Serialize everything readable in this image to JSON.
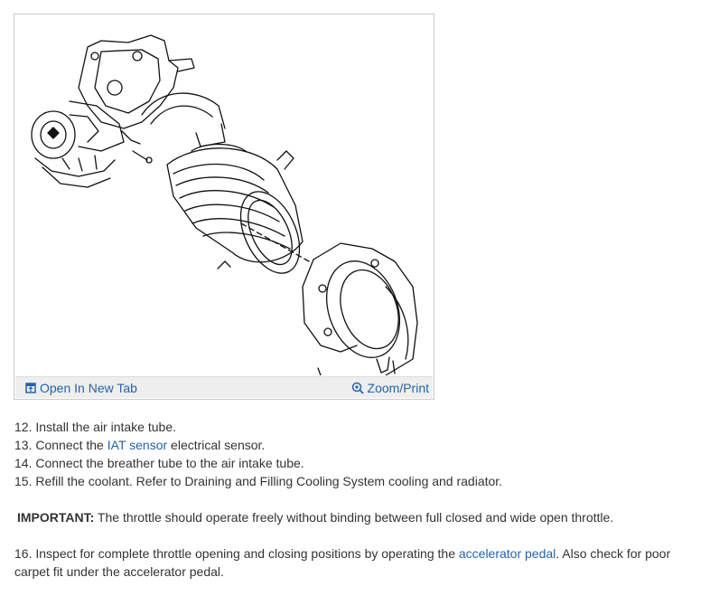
{
  "figure": {
    "open_label": "Open In New Tab",
    "zoom_label": "Zoom/Print",
    "accent_color": "#2563a9"
  },
  "steps": {
    "s12": "12. Install the air intake tube.",
    "s13_pre": "13. Connect the ",
    "s13_link": "IAT sensor",
    "s13_post": " electrical sensor.",
    "s14": "14. Connect the breather tube to the air intake tube.",
    "s15": "15. Refill the coolant. Refer to Draining and Filling Cooling System cooling and radiator.",
    "important_label": "IMPORTANT:",
    "important_text": " The throttle should operate freely without binding between full closed and wide open throttle.",
    "s16_pre": "16. Inspect for complete throttle opening and closing positions by operating the ",
    "s16_link": "accelerator pedal",
    "s16_mid": ". Also check for poor",
    "s16_line2": "carpet fit under the accelerator pedal."
  }
}
